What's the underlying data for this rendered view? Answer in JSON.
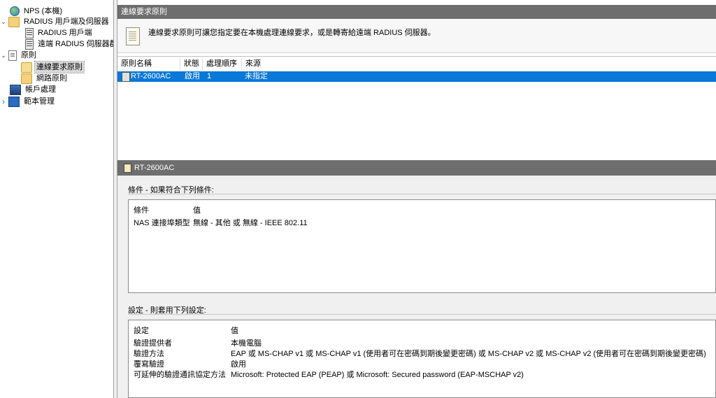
{
  "tree": {
    "nodes": [
      {
        "label": "NPS (本機)",
        "icon": "globe-icon",
        "twisty": ""
      },
      {
        "label": "RADIUS 用戶端及伺服器",
        "icon": "folder-icon",
        "twisty": "⌄"
      },
      {
        "label": "RADIUS 用戶端",
        "icon": "grid-icon",
        "twisty": ""
      },
      {
        "label": "遠端 RADIUS 伺服器群",
        "icon": "grid-icon",
        "twisty": ""
      },
      {
        "label": "原則",
        "icon": "document-icon",
        "twisty": "⌄"
      },
      {
        "label": "連線要求原則",
        "icon": "open-folder-icon",
        "twisty": ""
      },
      {
        "label": "網路原則",
        "icon": "folder-icon",
        "twisty": ""
      },
      {
        "label": "帳戶處理",
        "icon": "accounting-icon",
        "twisty": ""
      },
      {
        "label": "範本管理",
        "icon": "monitor-icon",
        "twisty": "›"
      }
    ]
  },
  "header": {
    "title": "連線要求原則"
  },
  "description": {
    "text": "連線要求原則可讓您指定要在本機處理連線要求，或是轉寄給遠端 RADIUS 伺服器。"
  },
  "list": {
    "columns": [
      "原則名稱",
      "狀態",
      "處理順序",
      "來源"
    ],
    "rows": [
      {
        "name": "RT-2600AC",
        "status": "啟用",
        "order": "1",
        "source": "未指定"
      }
    ]
  },
  "detail": {
    "title": "RT-2600AC",
    "conditions_label": "條件 - 如果符合下列條件:",
    "conditions_headers": [
      "條件",
      "值"
    ],
    "conditions": [
      {
        "name": "NAS 連接埠類型",
        "value": "無線 - 其他 或 無線 - IEEE 802.11"
      }
    ],
    "settings_label": "設定 - 則套用下列設定:",
    "settings_headers": [
      "設定",
      "值"
    ],
    "settings": [
      {
        "name": "驗證提供者",
        "value": "本機電腦"
      },
      {
        "name": "驗證方法",
        "value": "EAP 或 MS-CHAP v1 或 MS-CHAP v1 (使用者可在密碼到期後變更密碼) 或 MS-CHAP v2 或 MS-CHAP v2 (使用者可在密碼到期後變更密碼)"
      },
      {
        "name": "覆寫驗證",
        "value": "啟用"
      },
      {
        "name": "可延伸的驗證通訊協定方法",
        "value": "Microsoft: Protected EAP (PEAP) 或 Microsoft: Secured password (EAP-MSCHAP v2)"
      }
    ]
  },
  "colors": {
    "selection": "#0a78d7",
    "header_bar": "#6e6e6e"
  }
}
